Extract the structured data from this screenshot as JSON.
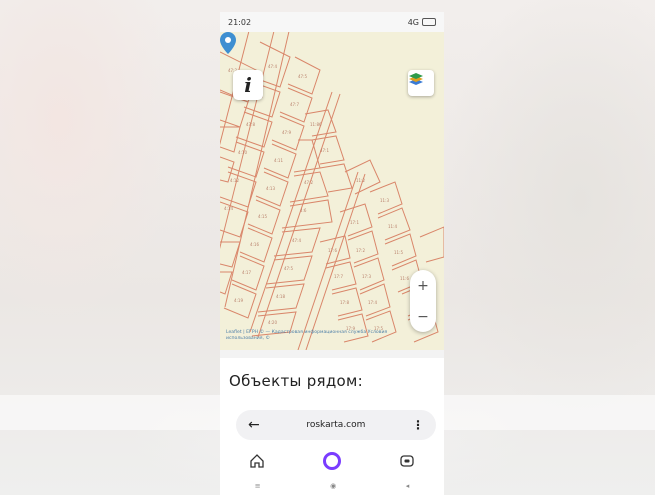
{
  "status_bar": {
    "time": "21:02",
    "signal": "4G"
  },
  "map": {
    "info_label": "i",
    "zoom_in": "+",
    "zoom_out": "−",
    "attribution": "Leaflet | ЕГРН © — Кадастровая информационная служба Условия использования, ©",
    "icons": {
      "info": "info-icon",
      "layers": "layers-icon",
      "marker": "location-pin-icon"
    }
  },
  "nearby": {
    "title": "Объекты рядом:"
  },
  "browser": {
    "url": "roskarta.com",
    "back": "←",
    "menu": "⋮",
    "icons": {
      "home": "home-icon",
      "assistant": "alice-icon",
      "tabs": "tabs-icon"
    }
  },
  "system_nav": {
    "menu": "≡",
    "home": "◉",
    "back": "◂"
  },
  "colors": {
    "map_bg": "#f3f0d9",
    "parcel_line": "#d9866a",
    "pin": "#3e8fd1"
  }
}
